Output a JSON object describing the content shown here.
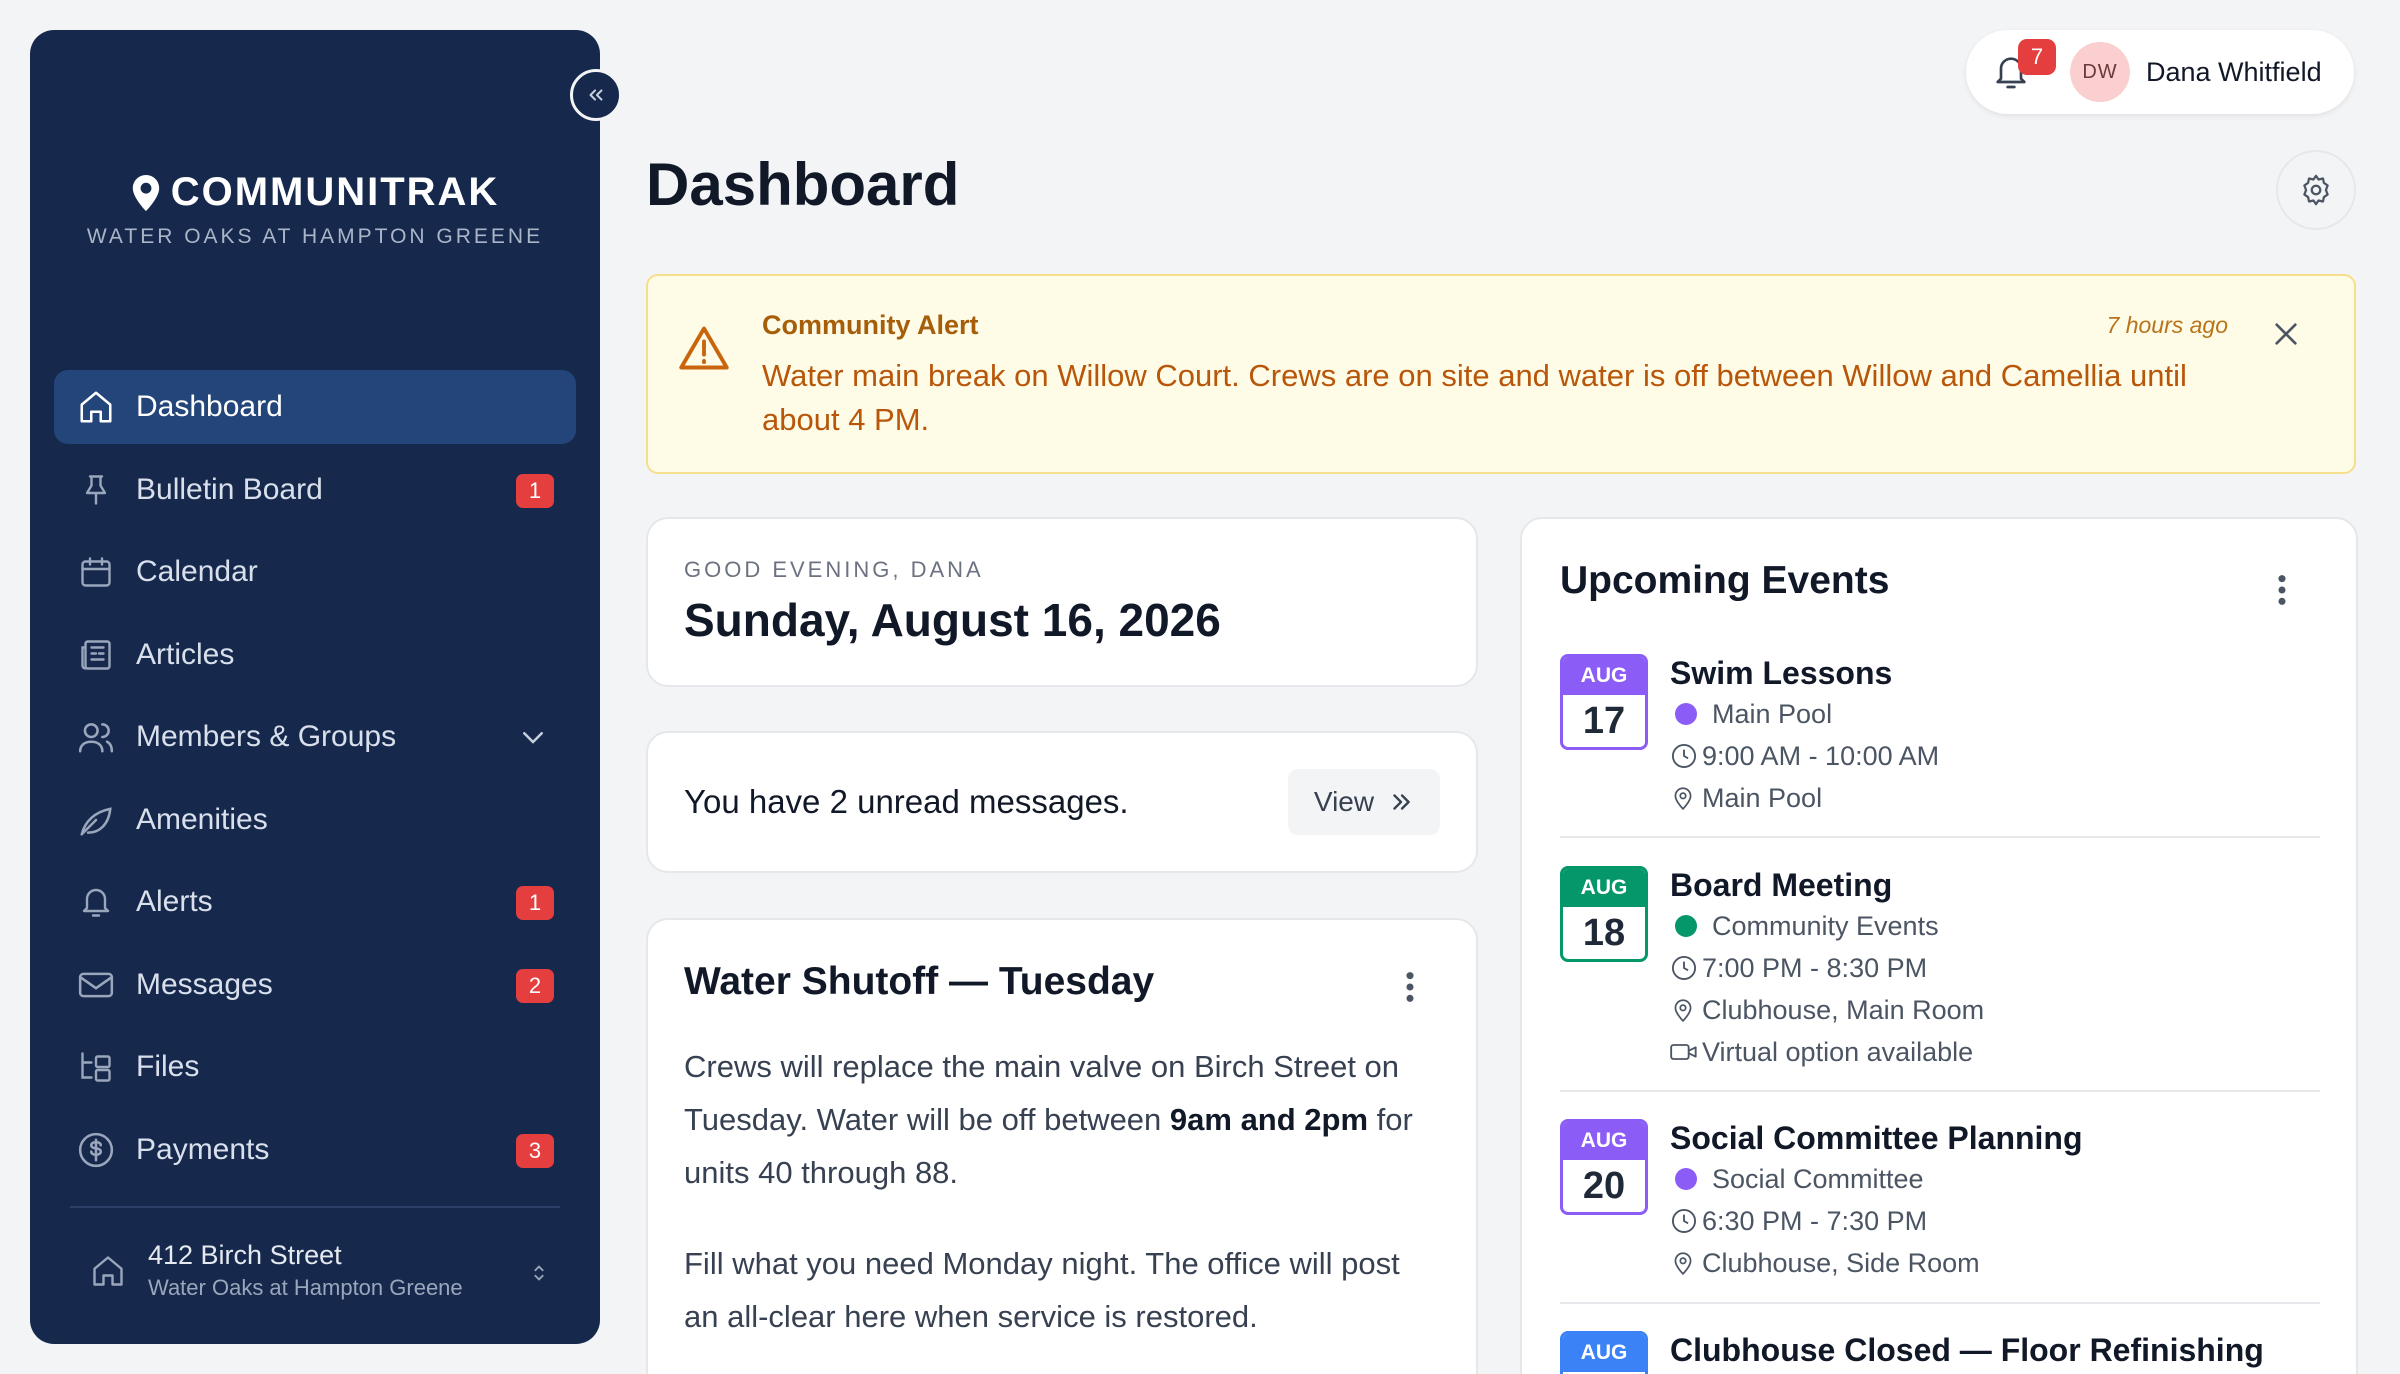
{
  "brand": {
    "name": "COMMUNITRAK",
    "community": "WATER OAKS AT HAMPTON GREENE"
  },
  "sidebar": {
    "items": [
      {
        "label": "Dashboard",
        "icon": "home-icon",
        "active": true
      },
      {
        "label": "Bulletin Board",
        "icon": "pin-icon",
        "badge": "1"
      },
      {
        "label": "Calendar",
        "icon": "calendar-icon"
      },
      {
        "label": "Articles",
        "icon": "newspaper-icon"
      },
      {
        "label": "Members & Groups",
        "icon": "users-icon",
        "expandable": true
      },
      {
        "label": "Amenities",
        "icon": "leaf-icon"
      },
      {
        "label": "Alerts",
        "icon": "bell-icon",
        "badge": "1"
      },
      {
        "label": "Messages",
        "icon": "mail-icon",
        "badge": "2"
      },
      {
        "label": "Files",
        "icon": "folder-tree-icon"
      },
      {
        "label": "Payments",
        "icon": "dollar-circle-icon",
        "badge": "3"
      }
    ],
    "address": {
      "street": "412 Birch Street",
      "community": "Water Oaks at Hampton Greene"
    }
  },
  "header": {
    "notifications_count": "7",
    "user_initials": "DW",
    "user_name": "Dana Whitfield",
    "page_title": "Dashboard"
  },
  "alert": {
    "label": "Community Alert",
    "time": "7 hours ago",
    "message": "Water main break on Willow Court. Crews are on site and water is off between Willow and Camellia until about 4 PM."
  },
  "greeting": {
    "subtitle": "GOOD EVENING, DANA",
    "date": "Sunday, August 16, 2026"
  },
  "messages_card": {
    "text": "You have 2 unread messages.",
    "button": "View"
  },
  "post": {
    "title": "Water Shutoff — Tuesday",
    "p1_before": "Crews will replace the main valve on Birch Street on Tuesday. Water will be off between ",
    "p1_bold": "9am and 2pm",
    "p1_after": " for units 40 through 88.",
    "p2": "Fill what you need Monday night. The office will post an all-clear here when service is restored."
  },
  "events": {
    "title": "Upcoming Events",
    "items": [
      {
        "month": "AUG",
        "day": "17",
        "title": "Swim Lessons",
        "category": "Main Pool",
        "color": "#8b5cf6",
        "time": "9:00 AM - 10:00 AM",
        "location": "Main Pool"
      },
      {
        "month": "AUG",
        "day": "18",
        "title": "Board Meeting",
        "category": "Community Events",
        "color": "#059669",
        "time": "7:00 PM - 8:30 PM",
        "location": "Clubhouse, Main Room",
        "virtual": "Virtual option available"
      },
      {
        "month": "AUG",
        "day": "20",
        "title": "Social Committee Planning",
        "category": "Social Committee",
        "color": "#8b5cf6",
        "time": "6:30 PM - 7:30 PM",
        "location": "Clubhouse, Side Room"
      },
      {
        "month": "AUG",
        "day": "",
        "title": "Clubhouse Closed — Floor Refinishing",
        "color": "#3b82f6"
      }
    ]
  }
}
